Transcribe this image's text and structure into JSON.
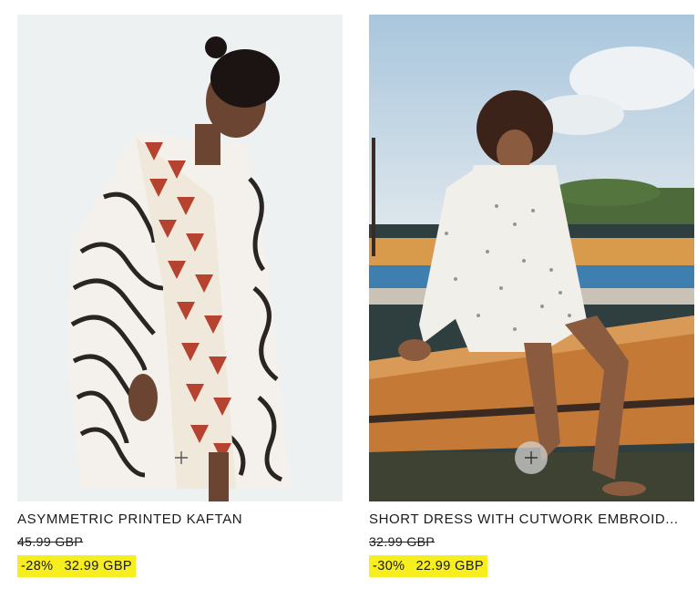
{
  "products": [
    {
      "name": "ASYMMETRIC PRINTED KAFTAN",
      "old_price": "45.99 GBP",
      "discount": "-28%",
      "new_price": "32.99 GBP",
      "image_desc": "model in zebra and red triangle print kaftan"
    },
    {
      "name": "SHORT DRESS WITH CUTWORK EMBROID...",
      "old_price": "32.99 GBP",
      "discount": "-30%",
      "new_price": "22.99 GBP",
      "image_desc": "model in white eyelet dress sitting on boat"
    }
  ],
  "colors": {
    "price_highlight": "#f6ee1e",
    "text": "#1a1a1a"
  },
  "icons": {
    "add": "plus-icon"
  }
}
